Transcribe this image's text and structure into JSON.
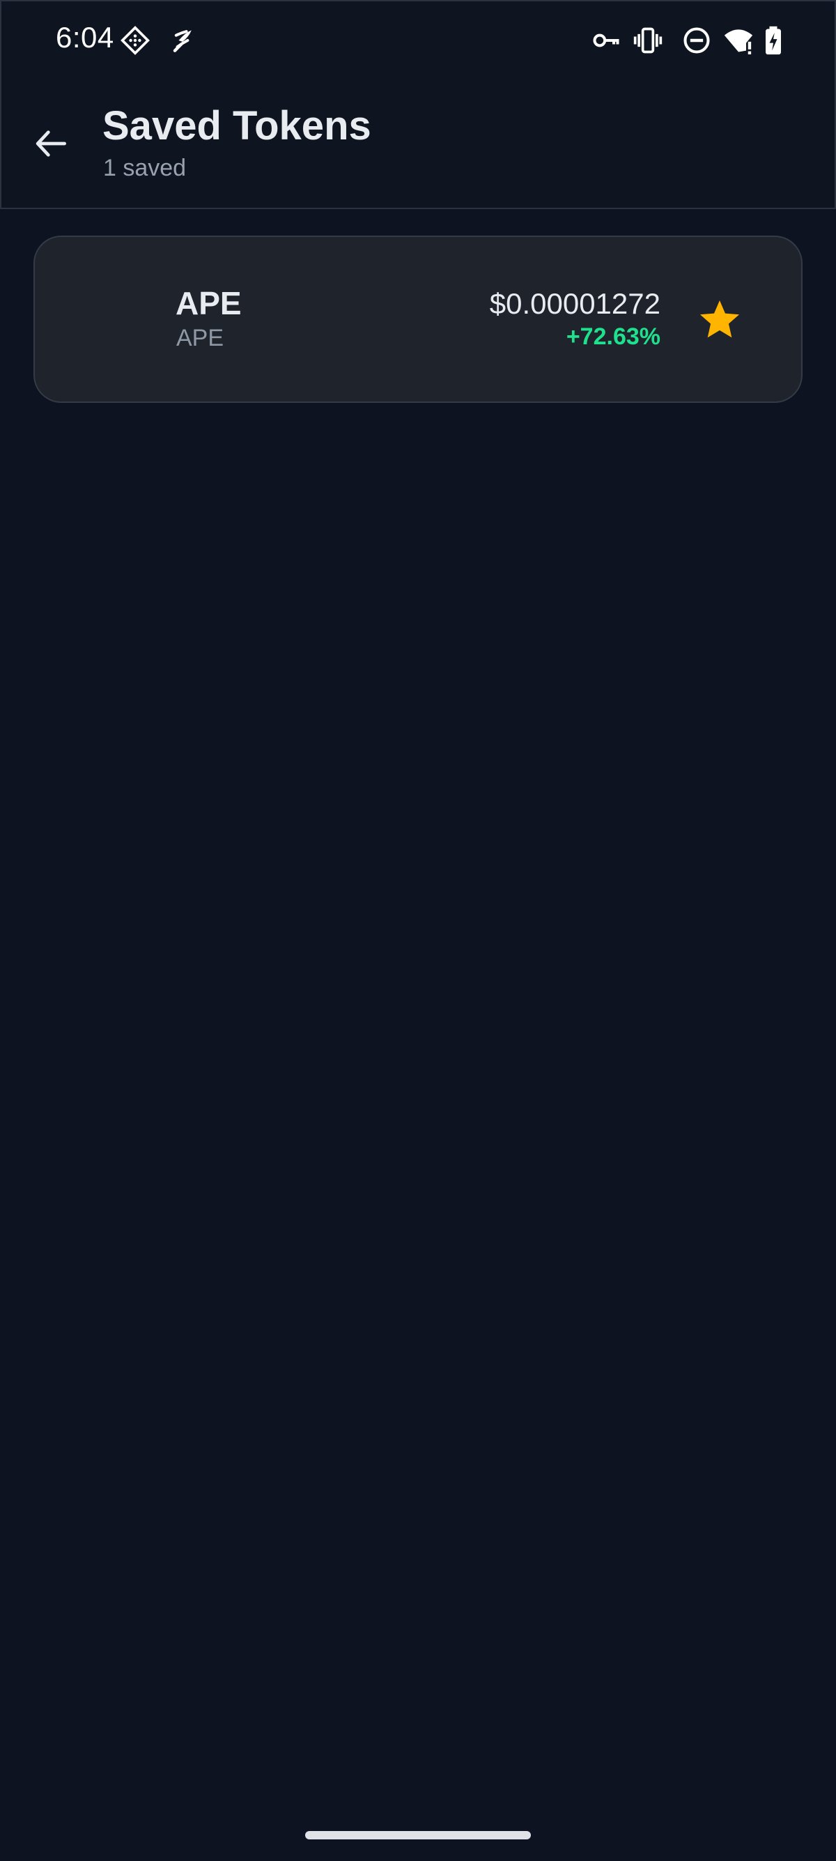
{
  "status_bar": {
    "time": "6:04",
    "left_icons": [
      "grid-diamond-icon",
      "feather-icon"
    ],
    "right_icons": [
      "key-icon",
      "vibrate-icon",
      "do-not-disturb-icon",
      "wifi-alert-icon",
      "battery-charging-icon"
    ]
  },
  "app_bar": {
    "back_icon": "arrow-left-icon",
    "title": "Saved Tokens",
    "subtitle": "1 saved"
  },
  "tokens": [
    {
      "symbol": "APE",
      "name": "APE",
      "price": "$0.00001272",
      "change": "+72.63%",
      "saved": true,
      "star_icon": "star-filled-icon"
    }
  ],
  "colors": {
    "background": "#0d1320",
    "header": "#0e1520",
    "card": "#1f242c",
    "positive_change": "#1ee08d",
    "star": "#ffb400"
  }
}
